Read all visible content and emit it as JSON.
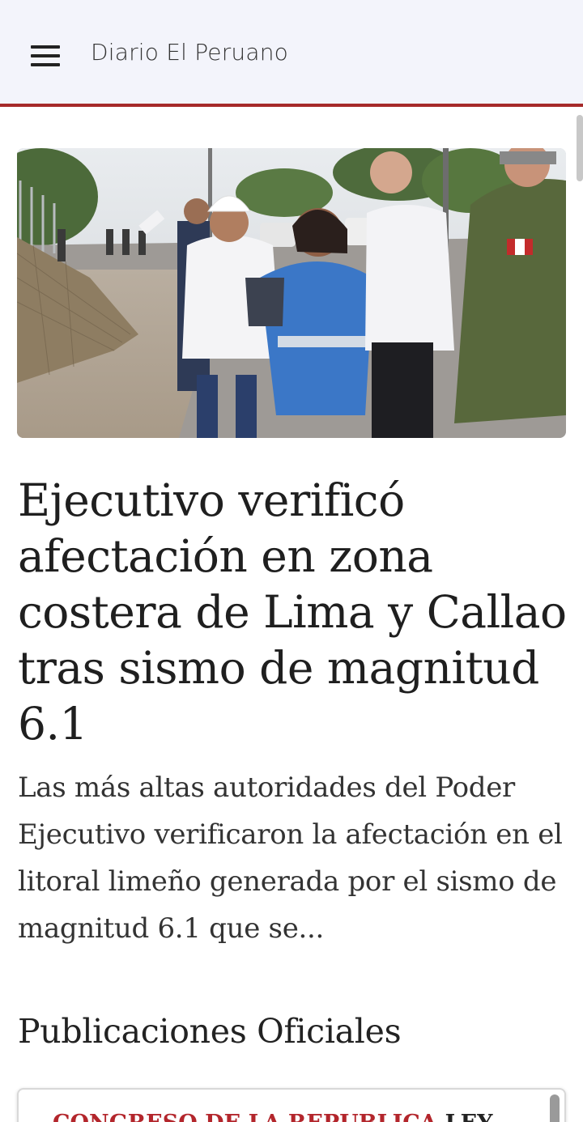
{
  "app": {
    "title": "Diario El Peruano"
  },
  "article": {
    "headline": "Ejecutivo verificó afectación en zona costera de Lima y Callao tras sismo de magnitud 6.1",
    "summary": "Las más altas autoridades del Poder Ejecutivo verificaron la afectación en el litoral limeño generada por el sismo de magnitud 6.1 que se..."
  },
  "sections": {
    "official_publications": {
      "title": "Publicaciones Oficiales",
      "first_item": {
        "entity": "CONGRESO DE LA REPUBLICA",
        "type": "LEY"
      }
    }
  },
  "colors": {
    "accent": "#a62a2a",
    "entity_red": "#b3262c",
    "appbar_bg": "#f3f4fb"
  },
  "icons": {
    "menu": "hamburger-menu-icon"
  }
}
